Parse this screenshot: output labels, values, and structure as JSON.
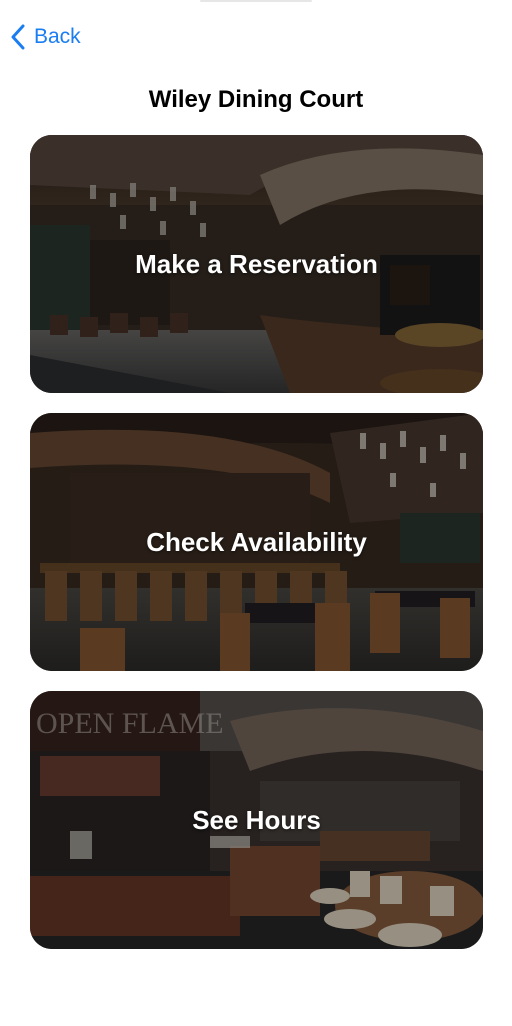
{
  "nav": {
    "back_label": "Back"
  },
  "page": {
    "title": "Wiley Dining Court"
  },
  "actions": [
    {
      "label": "Make a Reservation",
      "image": "dining-hall-photo"
    },
    {
      "label": "Check Availability",
      "image": "dining-seating-photo"
    },
    {
      "label": "See Hours",
      "image": "food-station-photo"
    }
  ],
  "scene_sign": "OPEN FLAME",
  "colors": {
    "accent": "#1a7df2",
    "title": "#000000",
    "card_text": "#ffffff"
  }
}
